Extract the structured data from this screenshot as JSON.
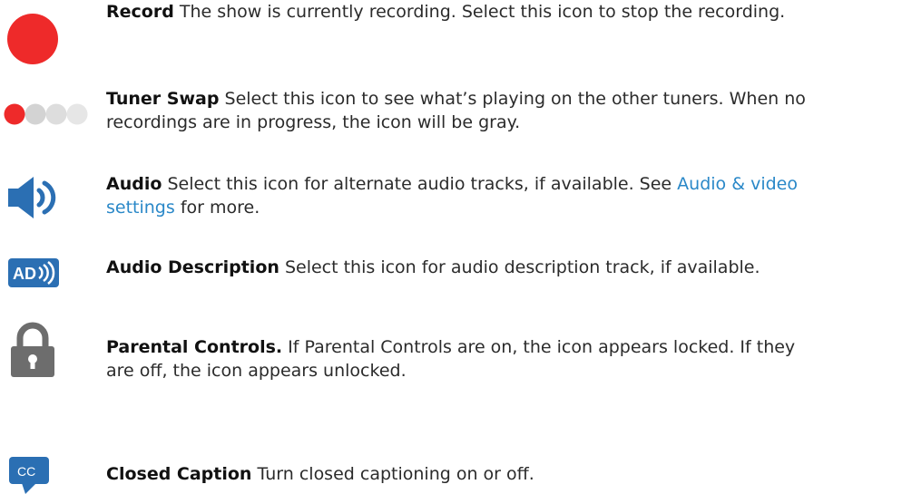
{
  "colors": {
    "record_red": "#ee2a2a",
    "icon_blue": "#2b6fb3",
    "icon_gray": "#6d6d6d",
    "link_blue": "#2a88c8"
  },
  "items": [
    {
      "icon": "record-icon",
      "title": "Record",
      "lines": [
        "The show is currently recording. Select this icon to stop the recording."
      ]
    },
    {
      "icon": "tuner-swap-icon",
      "title": "Tuner Swap",
      "lines": [
        "Select this icon to see what’s playing on the other tuners. When no",
        "recordings are in progress, the icon will be gray."
      ]
    },
    {
      "icon": "audio-icon",
      "title": "Audio",
      "text_before_link": "Select this icon for alternate audio tracks, if available. See ",
      "link_line1": "Audio & video",
      "link_line2": "settings",
      "text_after_link": " for more."
    },
    {
      "icon": "audio-description-icon",
      "icon_label": "AD",
      "title": "Audio Description",
      "lines": [
        "Select this icon for audio description track, if available."
      ]
    },
    {
      "icon": "lock-icon",
      "title": "Parental Controls.",
      "lines": [
        "If Parental Controls are on, the icon appears locked. If they",
        "are off, the icon appears unlocked."
      ]
    },
    {
      "icon": "closed-caption-icon",
      "icon_label": "CC",
      "title": "Closed Caption",
      "lines": [
        "Turn closed captioning on or off."
      ]
    }
  ]
}
